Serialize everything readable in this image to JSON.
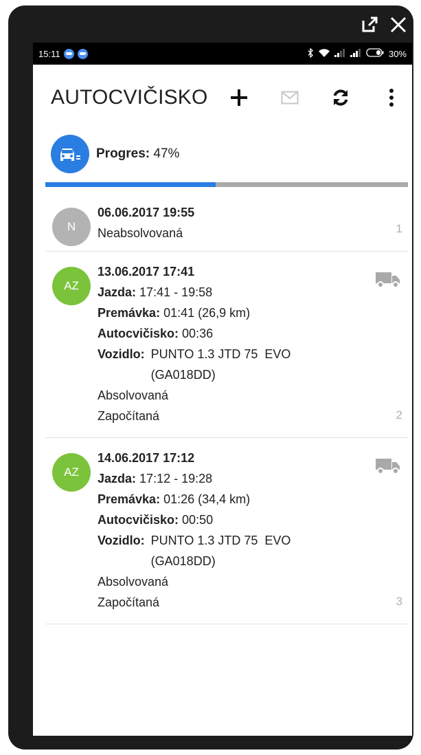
{
  "status_bar": {
    "time": "15:11",
    "battery": "30%"
  },
  "toolbar": {
    "title": "AUTOCVIČISKO"
  },
  "progress": {
    "label": "Progres:",
    "value_text": "47%",
    "value": 0.47
  },
  "entries": [
    {
      "initials": "N",
      "avatar_color": "#b3b3b3",
      "date": "06.06.2017 19:55",
      "status": "Neabsolvovaná",
      "number": "1"
    },
    {
      "initials": "AZ",
      "avatar_color": "#7cc33c",
      "date": "13.06.2017 17:41",
      "jazda_label": "Jazda:",
      "jazda": "17:41 - 19:58",
      "premavka_label": "Premávka:",
      "premavka": "01:41 (26,9 km)",
      "autocvicisko_label": "Autocvičisko:",
      "autocvicisko": "00:36",
      "vozidlo_label": "Vozidlo:",
      "vozidlo_line1": "PUNTO 1.3 JTD 75  EVO",
      "vozidlo_line2": "(GA018DD)",
      "status1": "Absolvovaná",
      "status2": "Započítaná",
      "number": "2"
    },
    {
      "initials": "AZ",
      "avatar_color": "#7cc33c",
      "date": "14.06.2017 17:12",
      "jazda_label": "Jazda:",
      "jazda": "17:12 - 19:28",
      "premavka_label": "Premávka:",
      "premavka": "01:26 (34,4 km)",
      "autocvicisko_label": "Autocvičisko:",
      "autocvicisko": "00:50",
      "vozidlo_label": "Vozidlo:",
      "vozidlo_line1": "PUNTO 1.3 JTD 75  EVO",
      "vozidlo_line2": "(GA018DD)",
      "status1": "Absolvovaná",
      "status2": "Započítaná",
      "number": "3"
    }
  ],
  "icons": {
    "window": [
      "external-link-icon",
      "close-icon"
    ],
    "toolbar": [
      "add-icon",
      "mail-icon",
      "sync-icon",
      "more-vert-icon"
    ],
    "progress": "car-icon",
    "entry": "truck-icon"
  },
  "colors": {
    "accent": "#2a7de1",
    "progress_track": "#aaaaaa",
    "truck": "#a9a9a9"
  }
}
